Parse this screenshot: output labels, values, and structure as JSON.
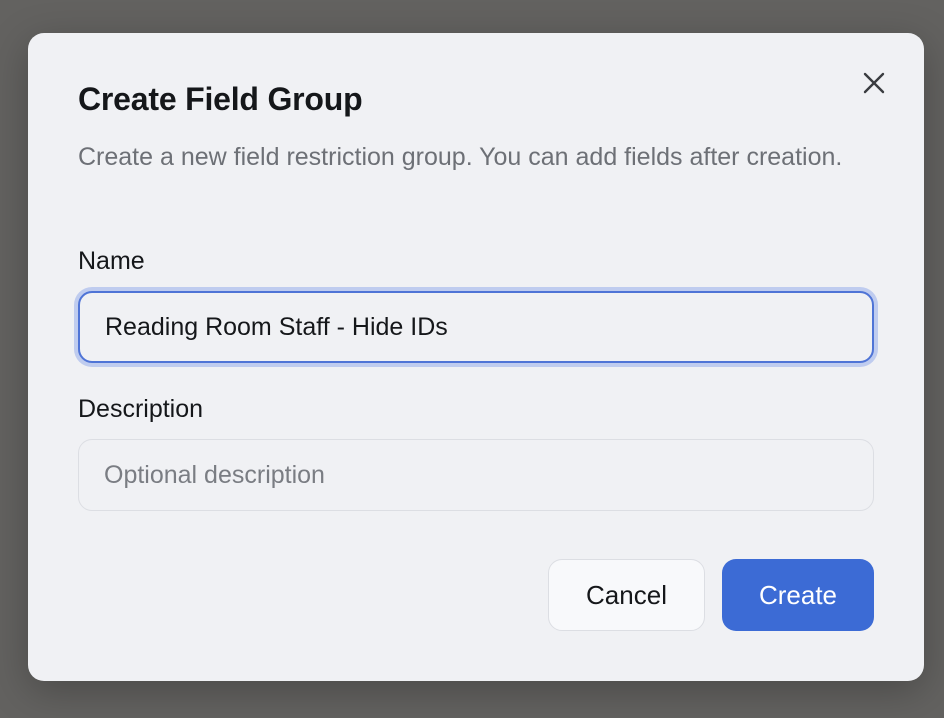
{
  "dialog": {
    "title": "Create Field Group",
    "description": "Create a new field restriction group. You can add fields after creation.",
    "close_icon": "close-icon",
    "fields": {
      "name": {
        "label": "Name",
        "value": "Reading Room Staff - Hide IDs"
      },
      "description": {
        "label": "Description",
        "placeholder": "Optional description",
        "value": ""
      }
    },
    "buttons": {
      "cancel_label": "Cancel",
      "create_label": "Create"
    }
  },
  "colors": {
    "backdrop": "#636260",
    "dialog_bg": "#f0f1f4",
    "primary": "#3c6bd5",
    "focus_ring": "#4f74d6",
    "muted_text": "#6d7076",
    "text": "#15171a"
  }
}
